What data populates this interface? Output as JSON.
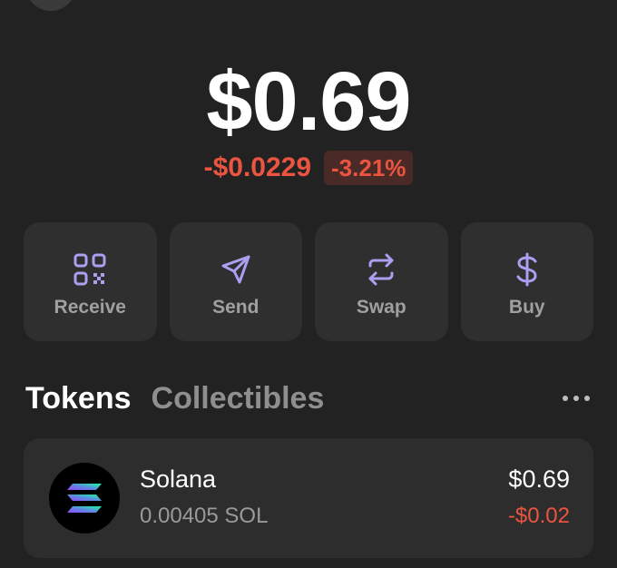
{
  "wallet": {
    "balance": "$0.69",
    "change_amount": "-$0.0229",
    "change_percent": "-3.21%"
  },
  "actions": [
    {
      "label": "Receive",
      "icon": "qr-code-icon"
    },
    {
      "label": "Send",
      "icon": "send-icon"
    },
    {
      "label": "Swap",
      "icon": "swap-icon"
    },
    {
      "label": "Buy",
      "icon": "dollar-icon"
    }
  ],
  "tabs": {
    "tokens_label": "Tokens",
    "collectibles_label": "Collectibles",
    "active": "Tokens"
  },
  "tokens": [
    {
      "name": "Solana",
      "amount": "0.00405 SOL",
      "value": "$0.69",
      "change": "-$0.02",
      "icon": "solana-logo-icon"
    }
  ],
  "colors": {
    "background": "#222222",
    "card": "#2f2f2f",
    "accent": "#ab9ff2",
    "negative": "#eb5440",
    "negative_badge_bg": "#4a2a26"
  }
}
